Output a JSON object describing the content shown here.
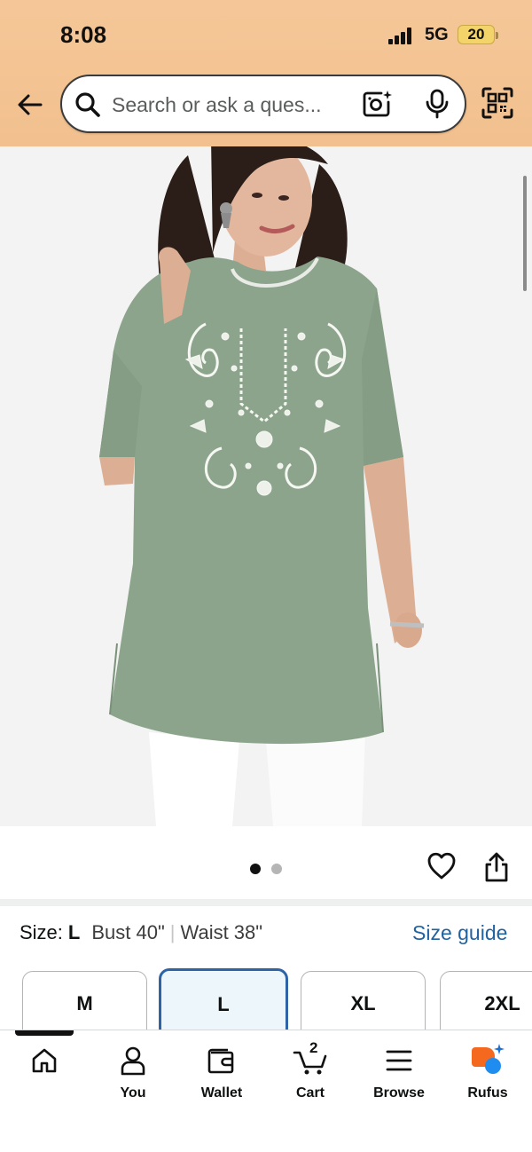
{
  "status_bar": {
    "time": "8:08",
    "network": "5G",
    "battery": "20"
  },
  "search": {
    "placeholder": "Search or ask a ques..."
  },
  "icons": {
    "back": "arrow-left-icon",
    "search": "search-icon",
    "camera": "camera-lens-icon",
    "mic": "microphone-icon",
    "qr": "qr-scan-icon",
    "heart": "heart-icon",
    "share": "share-icon"
  },
  "product": {
    "image_alt": "Sage green embroidered kurti with white embroidery, three-quarter sleeves"
  },
  "carousel": {
    "total_images": 2,
    "active_index": 0
  },
  "size": {
    "prefix": "Size:",
    "selected": "L",
    "bust": "Bust 40\"",
    "separator": "|",
    "waist": "Waist 38\"",
    "guide_label": "Size guide",
    "options": [
      "M",
      "L",
      "XL",
      "2XL"
    ]
  },
  "nav": {
    "items": [
      {
        "label": "",
        "icon": "home-icon"
      },
      {
        "label": "You",
        "icon": "user-icon"
      },
      {
        "label": "Wallet",
        "icon": "wallet-icon"
      },
      {
        "label": "Cart",
        "icon": "cart-icon",
        "count": "2"
      },
      {
        "label": "Browse",
        "icon": "menu-icon"
      },
      {
        "label": "Rufus",
        "icon": "rufus-icon"
      }
    ]
  },
  "colors": {
    "header_bg": "#f5c798",
    "link": "#2162a1",
    "selected_border": "#2e63a6",
    "kurti_green": "#8ba38b"
  }
}
